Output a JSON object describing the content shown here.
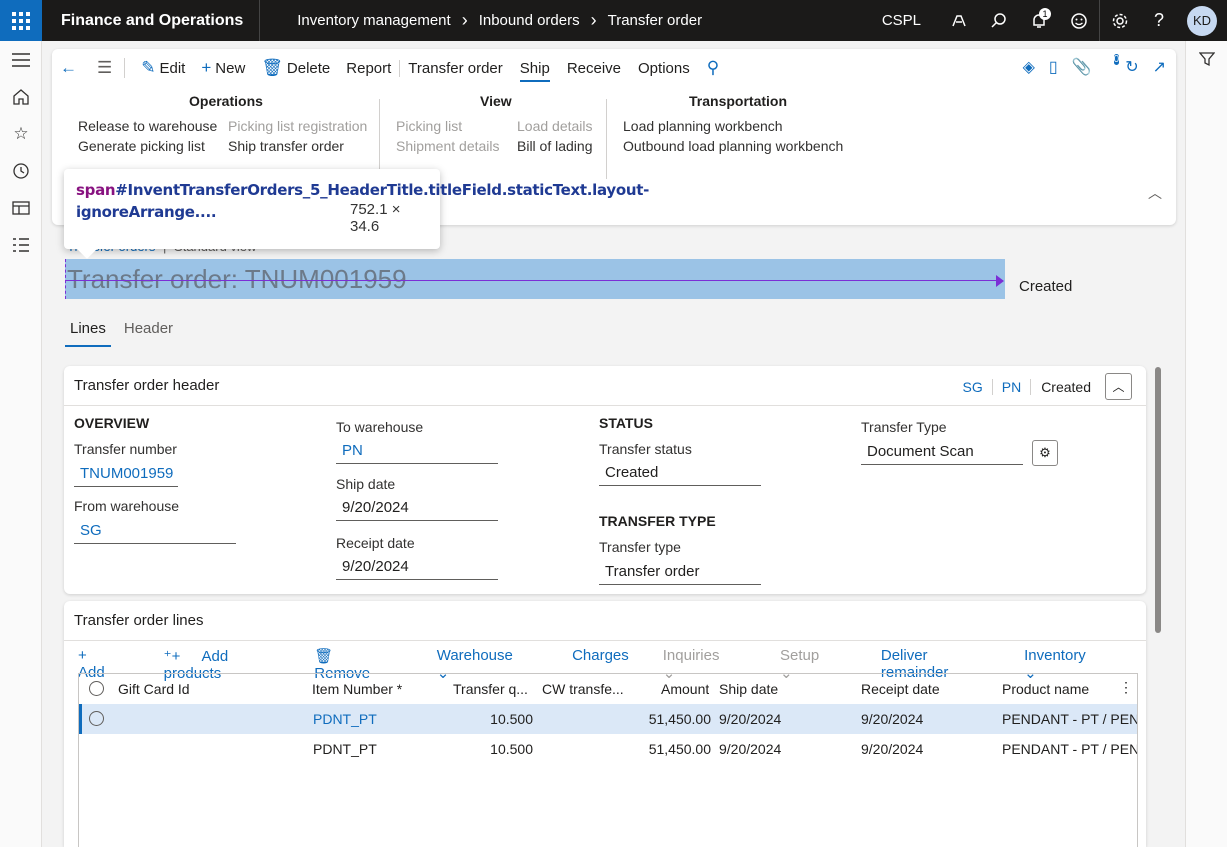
{
  "topbar": {
    "app_name": "Finance and Operations",
    "breadcrumbs": [
      "Inventory management",
      "Inbound orders",
      "Transfer order"
    ],
    "company": "CSPL",
    "notification_count": "1",
    "user_initials": "KD"
  },
  "action_pane": {
    "edit": "Edit",
    "new": "New",
    "delete": "Delete",
    "report": "Report",
    "tabs": [
      "Transfer order",
      "Ship",
      "Receive",
      "Options"
    ],
    "attachment_count": "0",
    "groups": {
      "operations": {
        "title": "Operations",
        "release_to_warehouse": "Release to warehouse",
        "generate_picking_list": "Generate picking list",
        "picking_list_registration": "Picking list registration",
        "ship_transfer_order": "Ship transfer order"
      },
      "view": {
        "title": "View",
        "picking_list": "Picking list",
        "shipment_details": "Shipment details",
        "load_details": "Load details",
        "bill_of_lading": "Bill of lading"
      },
      "transportation": {
        "title": "Transportation",
        "load_planning_workbench": "Load planning workbench",
        "outbound_load_planning_workbench": "Outbound load planning workbench"
      }
    }
  },
  "tooltip": {
    "tag": "span",
    "selector": "#InventTransferOrders_5_HeaderTitle.titleField.staticText.layout-ignoreArrange....",
    "size": "752.1 × 34.6"
  },
  "page": {
    "breadcrumb_partial": "Transfer orders",
    "view_name": "Standard view",
    "title": "Transfer order: TNUM001959",
    "status": "Created",
    "tabs": [
      "Lines",
      "Header"
    ]
  },
  "header_card": {
    "title": "Transfer order header",
    "summary_from": "SG",
    "summary_to": "PN",
    "summary_status": "Created",
    "overview_title": "OVERVIEW",
    "transfer_number_label": "Transfer number",
    "transfer_number": "TNUM001959",
    "from_warehouse_label": "From warehouse",
    "from_warehouse": "SG",
    "to_warehouse_label": "To warehouse",
    "to_warehouse": "PN",
    "ship_date_label": "Ship date",
    "ship_date": "9/20/2024",
    "receipt_date_label": "Receipt date",
    "receipt_date": "9/20/2024",
    "status_title": "STATUS",
    "transfer_status_label": "Transfer status",
    "transfer_status": "Created",
    "transfer_type_title": "TRANSFER TYPE",
    "transfer_type_label": "Transfer type",
    "transfer_type": "Transfer order",
    "transfer_type2_label": "Transfer Type",
    "transfer_type2": "Document Scan"
  },
  "lines_card": {
    "title": "Transfer order lines",
    "toolbar": {
      "add": "Add",
      "add_products": "Add products",
      "remove": "Remove",
      "warehouse": "Warehouse",
      "charges": "Charges",
      "inquiries": "Inquiries",
      "setup": "Setup",
      "deliver_remainder": "Deliver remainder",
      "inventory": "Inventory"
    },
    "columns": [
      "Gift Card Id",
      "Item Number *",
      "Transfer q...",
      "CW transfe...",
      "Amount",
      "Ship date",
      "Receipt date",
      "Product name"
    ],
    "rows": [
      {
        "gift_card": "",
        "item": "PDNT_PT",
        "qty": "10.500",
        "cw": "",
        "amount": "51,450.00",
        "ship": "9/20/2024",
        "receipt": "9/20/2024",
        "product": "PENDANT - PT / PENDANT"
      },
      {
        "gift_card": "",
        "item": "PDNT_PT",
        "qty": "10.500",
        "cw": "",
        "amount": "51,450.00",
        "ship": "9/20/2024",
        "receipt": "9/20/2024",
        "product": "PENDANT - PT / PENDANT"
      }
    ]
  }
}
